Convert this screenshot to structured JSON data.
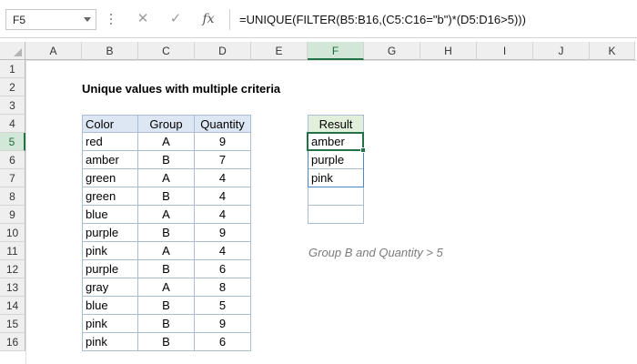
{
  "formula_bar": {
    "name_box": "F5",
    "cancel_icon": "✕",
    "enter_icon": "✓",
    "fx_label": "fx",
    "formula": "=UNIQUE(FILTER(B5:B16,(C5:C16=\"b\")*(D5:D16>5)))"
  },
  "grid": {
    "columns": [
      "A",
      "B",
      "C",
      "D",
      "E",
      "F",
      "G",
      "H",
      "I",
      "J",
      "K"
    ],
    "rows": [
      "1",
      "2",
      "3",
      "4",
      "5",
      "6",
      "7",
      "8",
      "9",
      "10",
      "11",
      "12",
      "13",
      "14",
      "15",
      "16"
    ],
    "selected_column": "F",
    "selected_row": "5"
  },
  "title": "Unique values with multiple criteria",
  "table": {
    "headers": [
      "Color",
      "Group",
      "Quantity"
    ],
    "rows": [
      [
        "red",
        "A",
        "9"
      ],
      [
        "amber",
        "B",
        "7"
      ],
      [
        "green",
        "A",
        "4"
      ],
      [
        "green",
        "B",
        "4"
      ],
      [
        "blue",
        "A",
        "4"
      ],
      [
        "purple",
        "B",
        "9"
      ],
      [
        "pink",
        "A",
        "4"
      ],
      [
        "purple",
        "B",
        "6"
      ],
      [
        "gray",
        "A",
        "8"
      ],
      [
        "blue",
        "B",
        "5"
      ],
      [
        "pink",
        "B",
        "9"
      ],
      [
        "pink",
        "B",
        "6"
      ]
    ]
  },
  "result": {
    "header": "Result",
    "values": [
      "amber",
      "purple",
      "pink",
      "",
      ""
    ]
  },
  "note": "Group B and Quantity > 5",
  "colors": {
    "accent": "#217346",
    "table_header": "#dde7f3",
    "result_header": "#e2efda",
    "spill_border": "#4f86c6"
  }
}
